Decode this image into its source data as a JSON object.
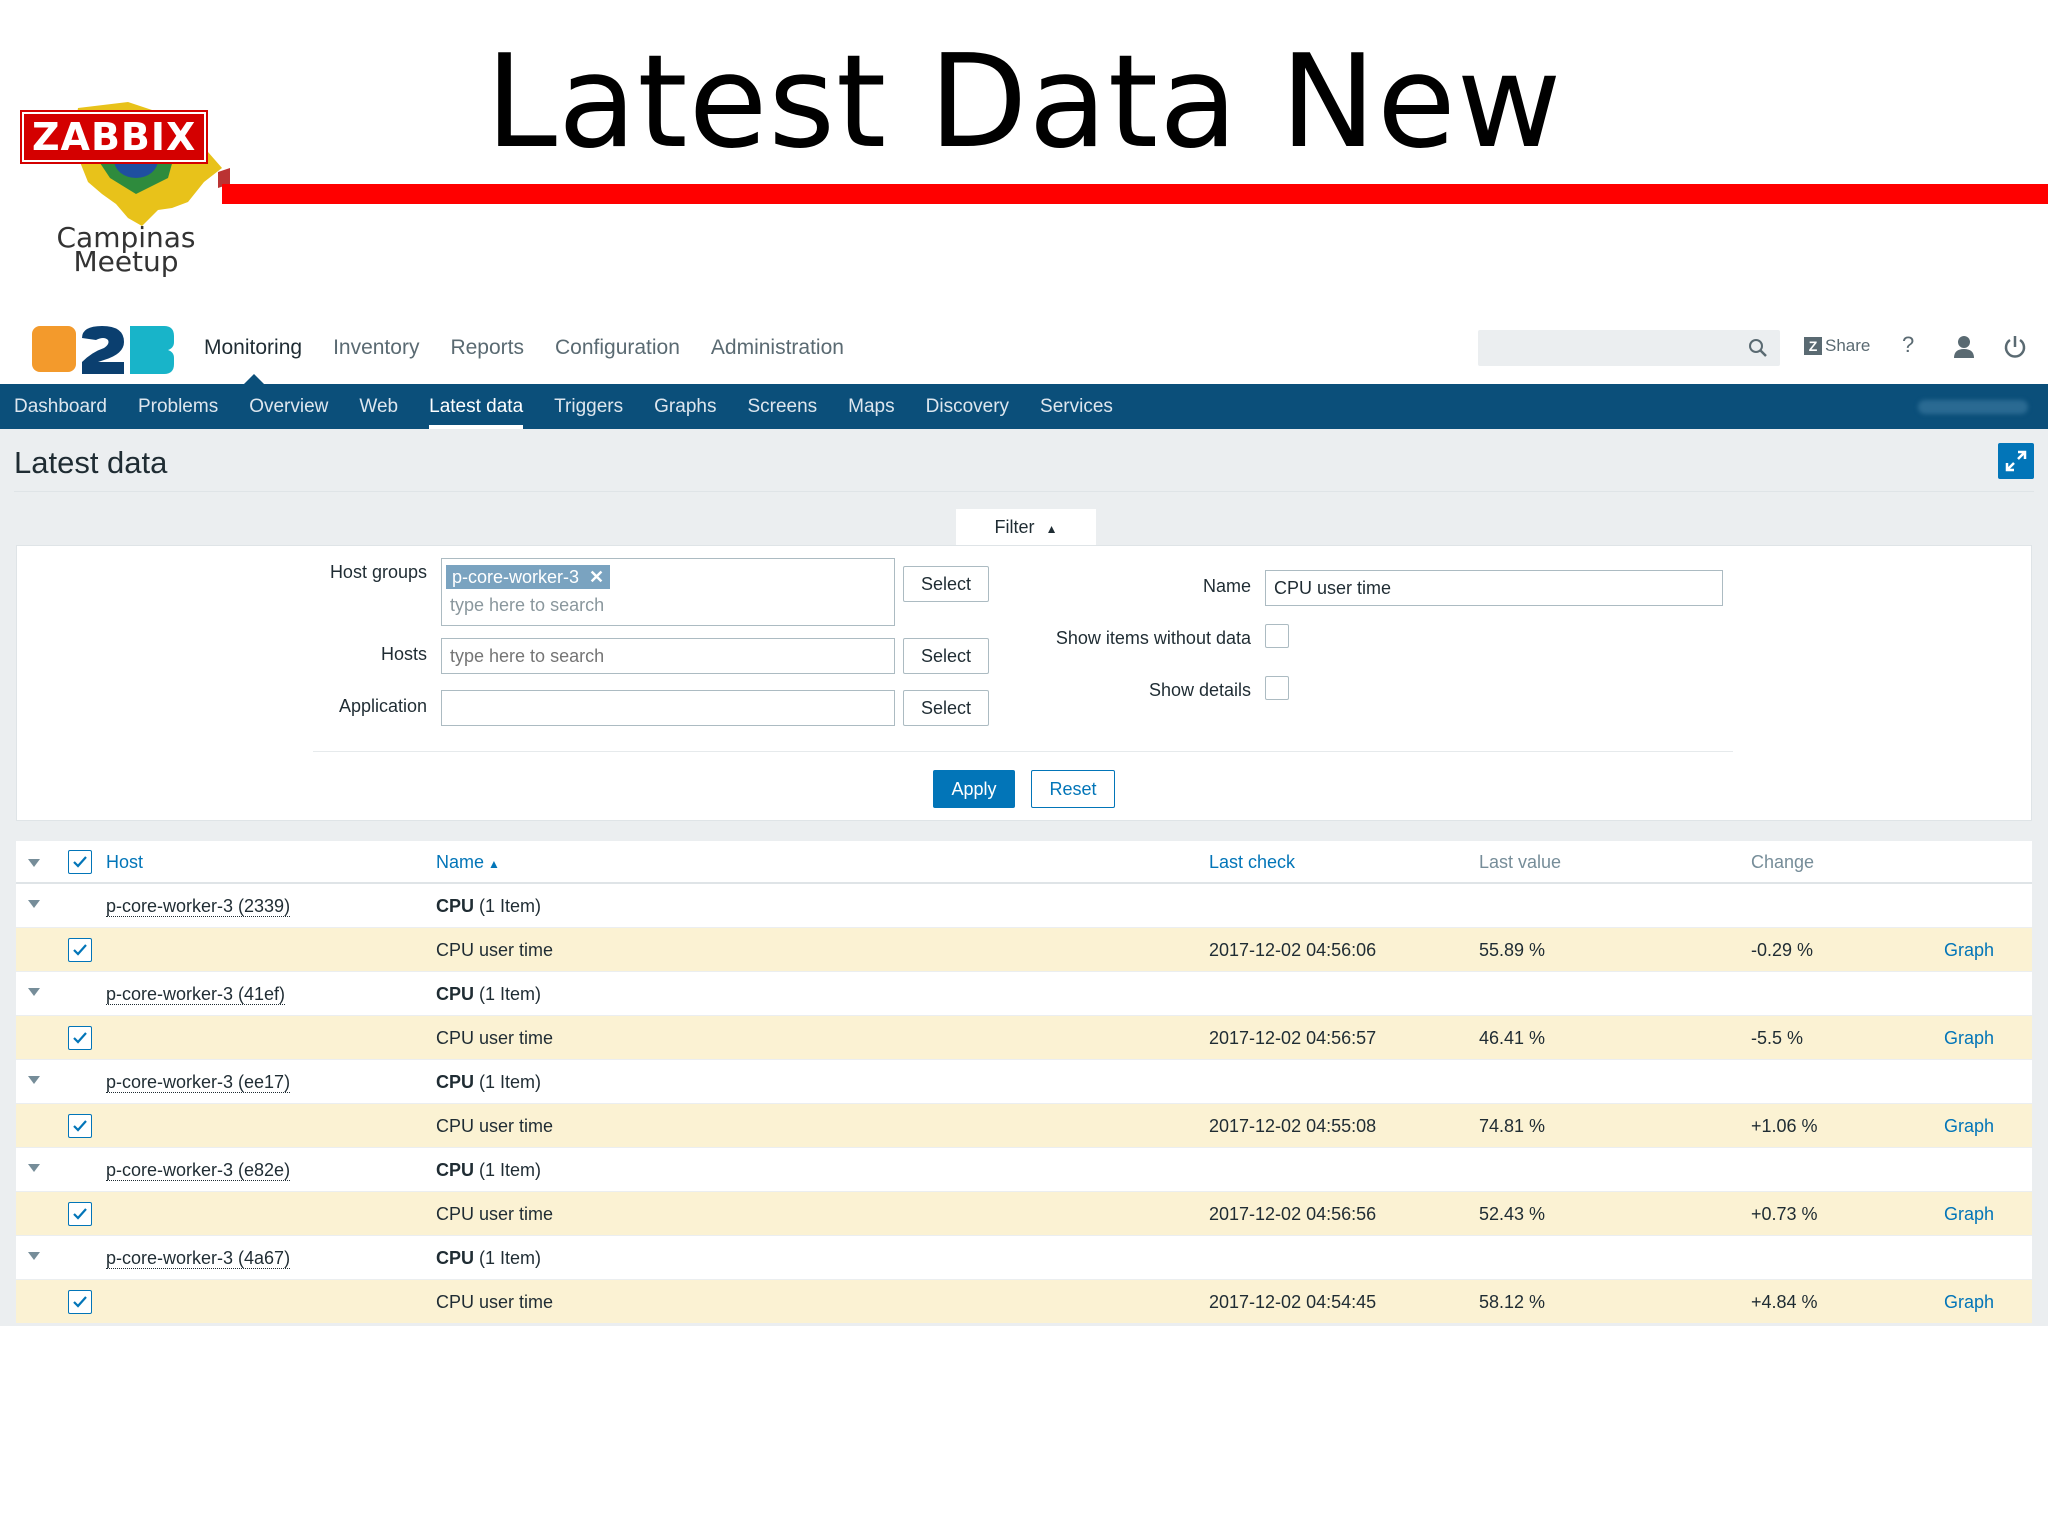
{
  "slide": {
    "title": "Latest Data New",
    "logo_badge": "ZABBIX",
    "logo_text_line1": "Campinas",
    "logo_text_line2": "Meetup"
  },
  "header": {
    "menu": [
      "Monitoring",
      "Inventory",
      "Reports",
      "Configuration",
      "Administration"
    ],
    "active_menu": "Monitoring",
    "search_value": "",
    "share_label": "Share",
    "help_label": "?"
  },
  "subnav": {
    "items": [
      "Dashboard",
      "Problems",
      "Overview",
      "Web",
      "Latest data",
      "Triggers",
      "Graphs",
      "Screens",
      "Maps",
      "Discovery",
      "Services"
    ],
    "active": "Latest data"
  },
  "page": {
    "title": "Latest data"
  },
  "filter": {
    "tab_label": "Filter",
    "host_groups_label": "Host groups",
    "host_group_chip": "p-core-worker-3",
    "host_groups_placeholder": "type here to search",
    "hosts_label": "Hosts",
    "hosts_placeholder": "type here to search",
    "application_label": "Application",
    "application_value": "",
    "select_label": "Select",
    "name_label": "Name",
    "name_value": "CPU user time",
    "show_without_data_label": "Show items without data",
    "show_details_label": "Show details",
    "show_without_data_checked": false,
    "show_details_checked": false,
    "apply_label": "Apply",
    "reset_label": "Reset"
  },
  "table": {
    "columns": {
      "host": "Host",
      "name": "Name",
      "last_check": "Last check",
      "last_value": "Last value",
      "change": "Change"
    },
    "groups": [
      {
        "host": "p-core-worker-3 (2339)",
        "app_bold": "CPU",
        "app_count": "(1 Item)",
        "item": {
          "name": "CPU user time",
          "last_check": "2017-12-02 04:56:06",
          "last_value": "55.89 %",
          "change": "-0.29 %",
          "graph": "Graph"
        }
      },
      {
        "host": "p-core-worker-3 (41ef)",
        "app_bold": "CPU",
        "app_count": "(1 Item)",
        "item": {
          "name": "CPU user time",
          "last_check": "2017-12-02 04:56:57",
          "last_value": "46.41 %",
          "change": "-5.5 %",
          "graph": "Graph"
        }
      },
      {
        "host": "p-core-worker-3 (ee17)",
        "app_bold": "CPU",
        "app_count": "(1 Item)",
        "item": {
          "name": "CPU user time",
          "last_check": "2017-12-02 04:55:08",
          "last_value": "74.81 %",
          "change": "+1.06 %",
          "graph": "Graph"
        }
      },
      {
        "host": "p-core-worker-3 (e82e)",
        "app_bold": "CPU",
        "app_count": "(1 Item)",
        "item": {
          "name": "CPU user time",
          "last_check": "2017-12-02 04:56:56",
          "last_value": "52.43 %",
          "change": "+0.73 %",
          "graph": "Graph"
        }
      },
      {
        "host": "p-core-worker-3 (4a67)",
        "app_bold": "CPU",
        "app_count": "(1 Item)",
        "item": {
          "name": "CPU user time",
          "last_check": "2017-12-02 04:54:45",
          "last_value": "58.12 %",
          "change": "+4.84 %",
          "graph": "Graph"
        }
      }
    ]
  },
  "colors": {
    "nav_bg": "#0b4f7a",
    "accent": "#0275b8",
    "item_row_bg": "#fbf2d3",
    "slide_bar": "#ff0000"
  }
}
